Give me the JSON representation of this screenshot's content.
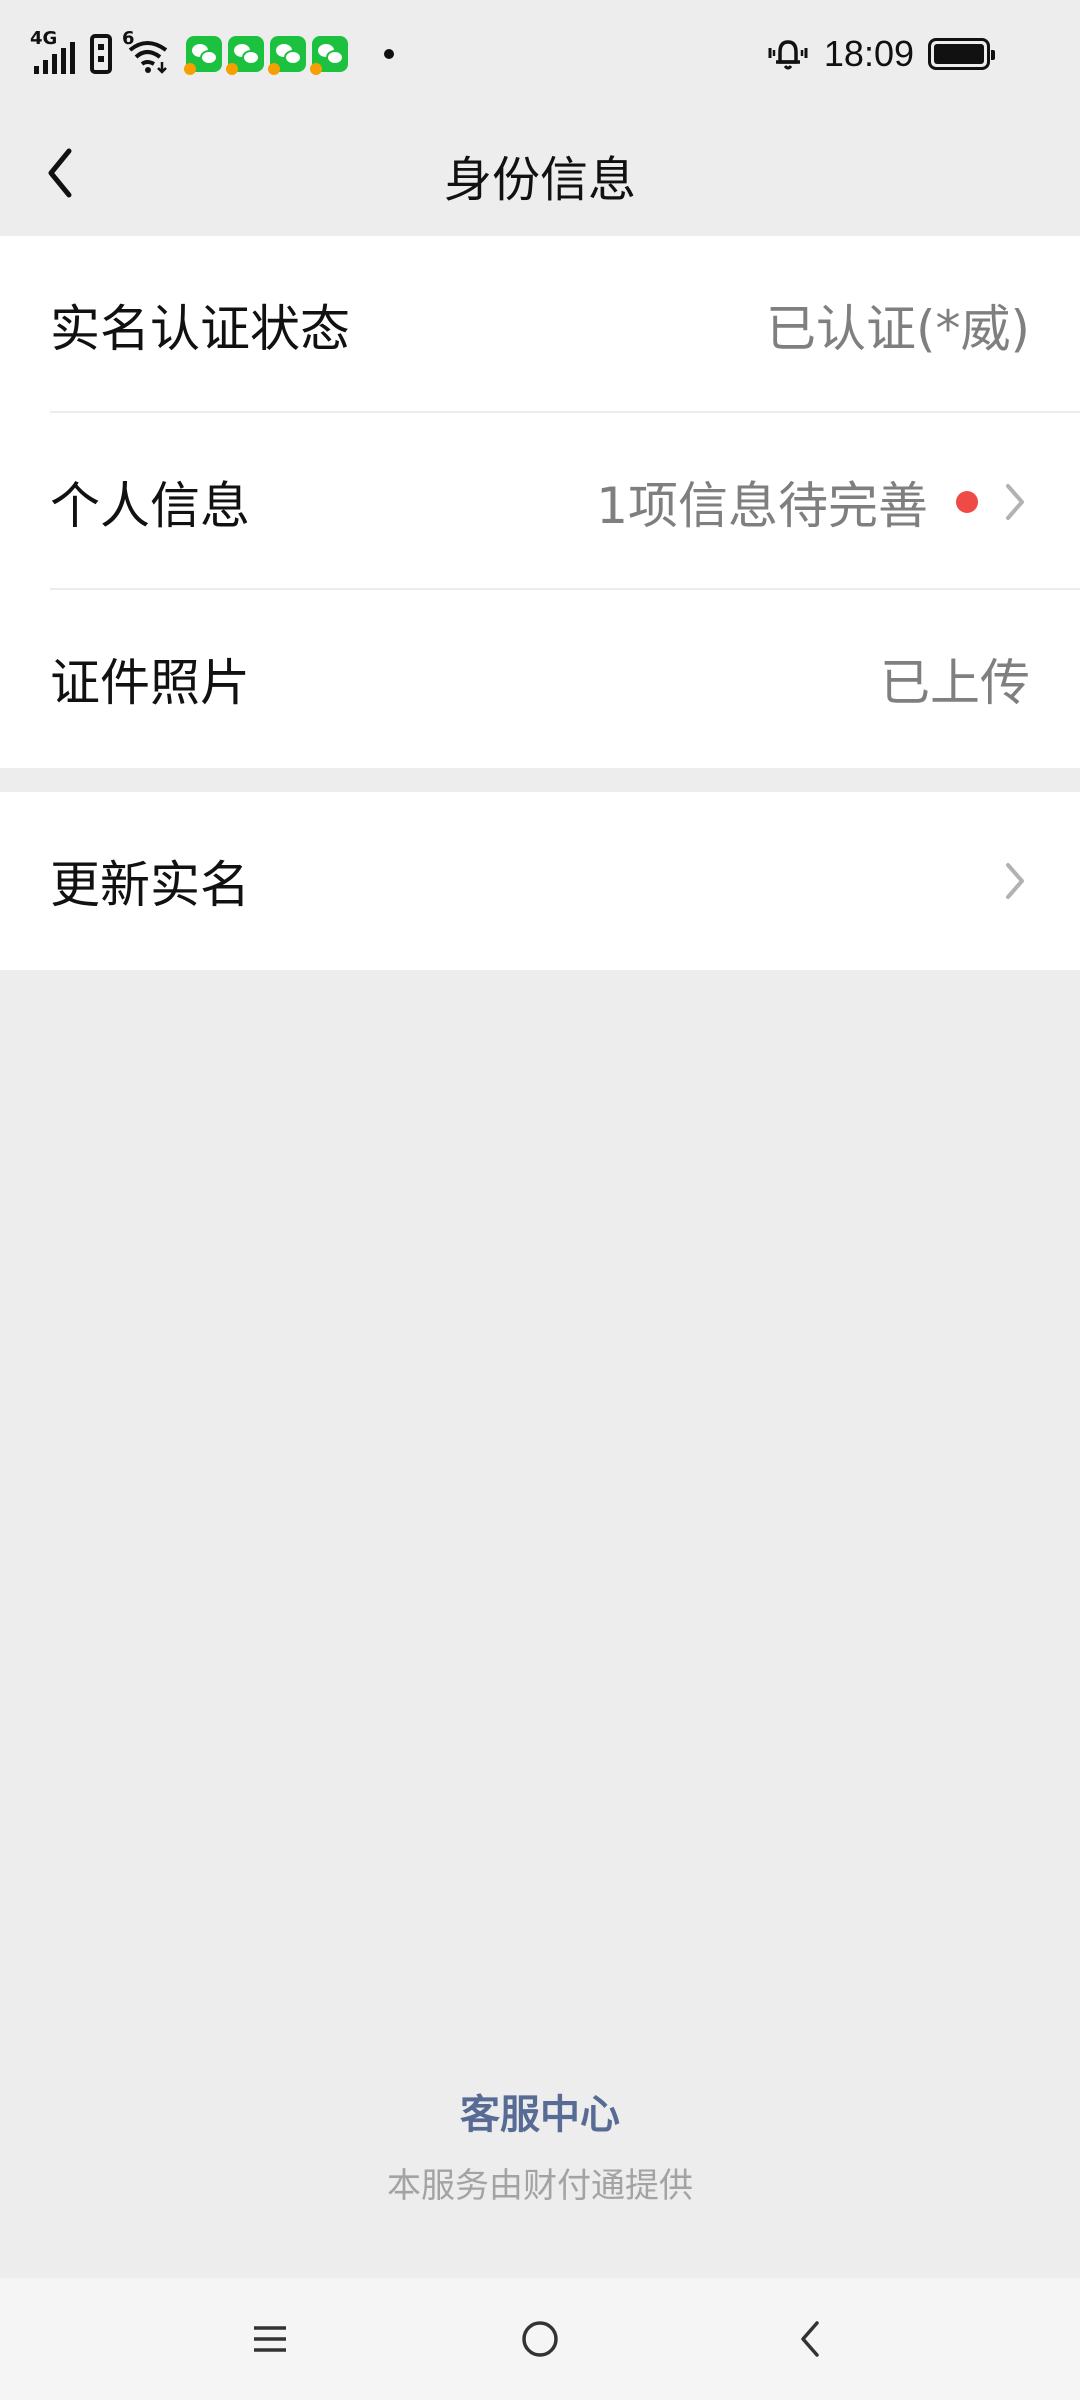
{
  "status_bar": {
    "network_type": "4G",
    "wifi_label": "6",
    "time": "18:09",
    "notification_icons": [
      "wechat-icon",
      "wechat-icon",
      "wechat-icon",
      "wechat-icon"
    ],
    "battery_level": 0.95
  },
  "nav": {
    "title": "身份信息",
    "back_icon": "chevron-left-icon"
  },
  "identity_section": {
    "rows": [
      {
        "label": "实名认证状态",
        "value": "已认证(*威)"
      },
      {
        "label": "个人信息",
        "value": "1项信息待完善"
      },
      {
        "label": "证件照片",
        "value": "已上传"
      }
    ]
  },
  "update_section": {
    "label": "更新实名"
  },
  "footer": {
    "service_link": "客服中心",
    "provider_text": "本服务由财付通提供"
  },
  "system_nav": {
    "menu_icon": "menu-icon",
    "home_icon": "home-circle-icon",
    "back_icon": "back-triangle-icon"
  },
  "colors": {
    "background": "#ededed",
    "link": "#576b95",
    "alert_dot": "#f04a46",
    "value_text": "#7f7f7f"
  }
}
